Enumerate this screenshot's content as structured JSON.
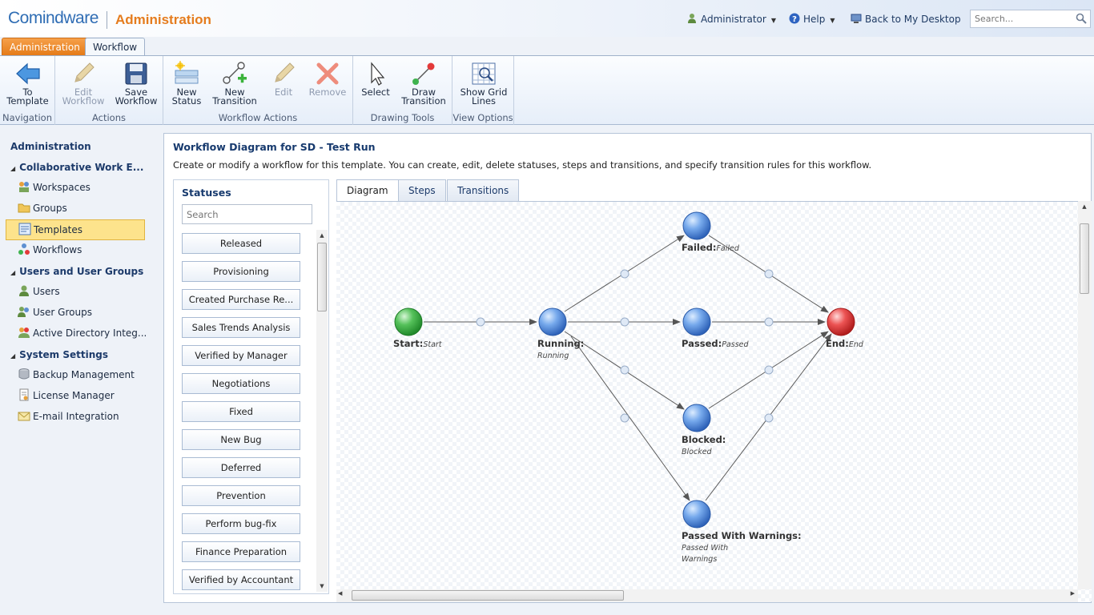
{
  "header": {
    "logo_text": "Comindware",
    "app_title": "Administration",
    "user_label": "Administrator",
    "help_label": "Help",
    "back_label": "Back to My Desktop",
    "search_placeholder": "Search..."
  },
  "tabs": {
    "administration": "Administration",
    "workflow": "Workflow"
  },
  "ribbon": {
    "groups": {
      "navigation": "Navigation",
      "actions": "Actions",
      "workflow_actions": "Workflow Actions",
      "drawing_tools": "Drawing Tools",
      "view_options": "View Options"
    },
    "to_template": [
      "To",
      "Template"
    ],
    "edit_workflow": [
      "Edit",
      "Workflow"
    ],
    "save_workflow": [
      "Save",
      "Workflow"
    ],
    "new_status": [
      "New",
      "Status"
    ],
    "new_transition": [
      "New",
      "Transition"
    ],
    "edit": "Edit",
    "remove": "Remove",
    "select": "Select",
    "draw_transition": [
      "Draw",
      "Transition"
    ],
    "show_grid_lines": [
      "Show Grid",
      "Lines"
    ]
  },
  "nav": {
    "administration": "Administration",
    "collab": "Collaborative Work E...",
    "workspaces": "Workspaces",
    "groups": "Groups",
    "templates": "Templates",
    "workflows": "Workflows",
    "users_groups": "Users and User Groups",
    "users": "Users",
    "user_groups": "User Groups",
    "active_directory": "Active Directory Integ...",
    "system_settings": "System Settings",
    "backup": "Backup Management",
    "license": "License Manager",
    "email": "E-mail Integration"
  },
  "main": {
    "title": "Workflow Diagram for SD - Test Run",
    "description": "Create or modify a workflow for this template. You can create, edit, delete statuses, steps and transitions, and specify transition rules for this workflow."
  },
  "statuses": {
    "title": "Statuses",
    "search_placeholder": "Search",
    "items": [
      "Released",
      "Provisioning",
      "Created Purchase Re...",
      "Sales Trends Analysis",
      "Verified by Manager",
      "Negotiations",
      "Fixed",
      "New Bug",
      "Deferred",
      "Prevention",
      "Perform bug-fix",
      "Finance Preparation",
      "Verified by Accountant"
    ]
  },
  "diagram_tabs": {
    "diagram": "Diagram",
    "steps": "Steps",
    "transitions": "Transitions"
  },
  "diagram": {
    "nodes": {
      "start": {
        "label": "Start:",
        "sub": "Start"
      },
      "running": {
        "label": "Running:",
        "sub": "Running"
      },
      "failed": {
        "label": "Failed:",
        "sub": "Failed"
      },
      "passed": {
        "label": "Passed:",
        "sub": "Passed"
      },
      "blocked": {
        "label": "Blocked:",
        "sub": "Blocked"
      },
      "warnings": {
        "label": "Passed With Warnings:",
        "sub1": "Passed With",
        "sub2": "Warnings"
      },
      "end": {
        "label": "End:",
        "sub": "End"
      }
    }
  },
  "colors": {
    "accent": "#e57c1e",
    "brand": "#2f6db4",
    "selected": "#fde38c"
  }
}
